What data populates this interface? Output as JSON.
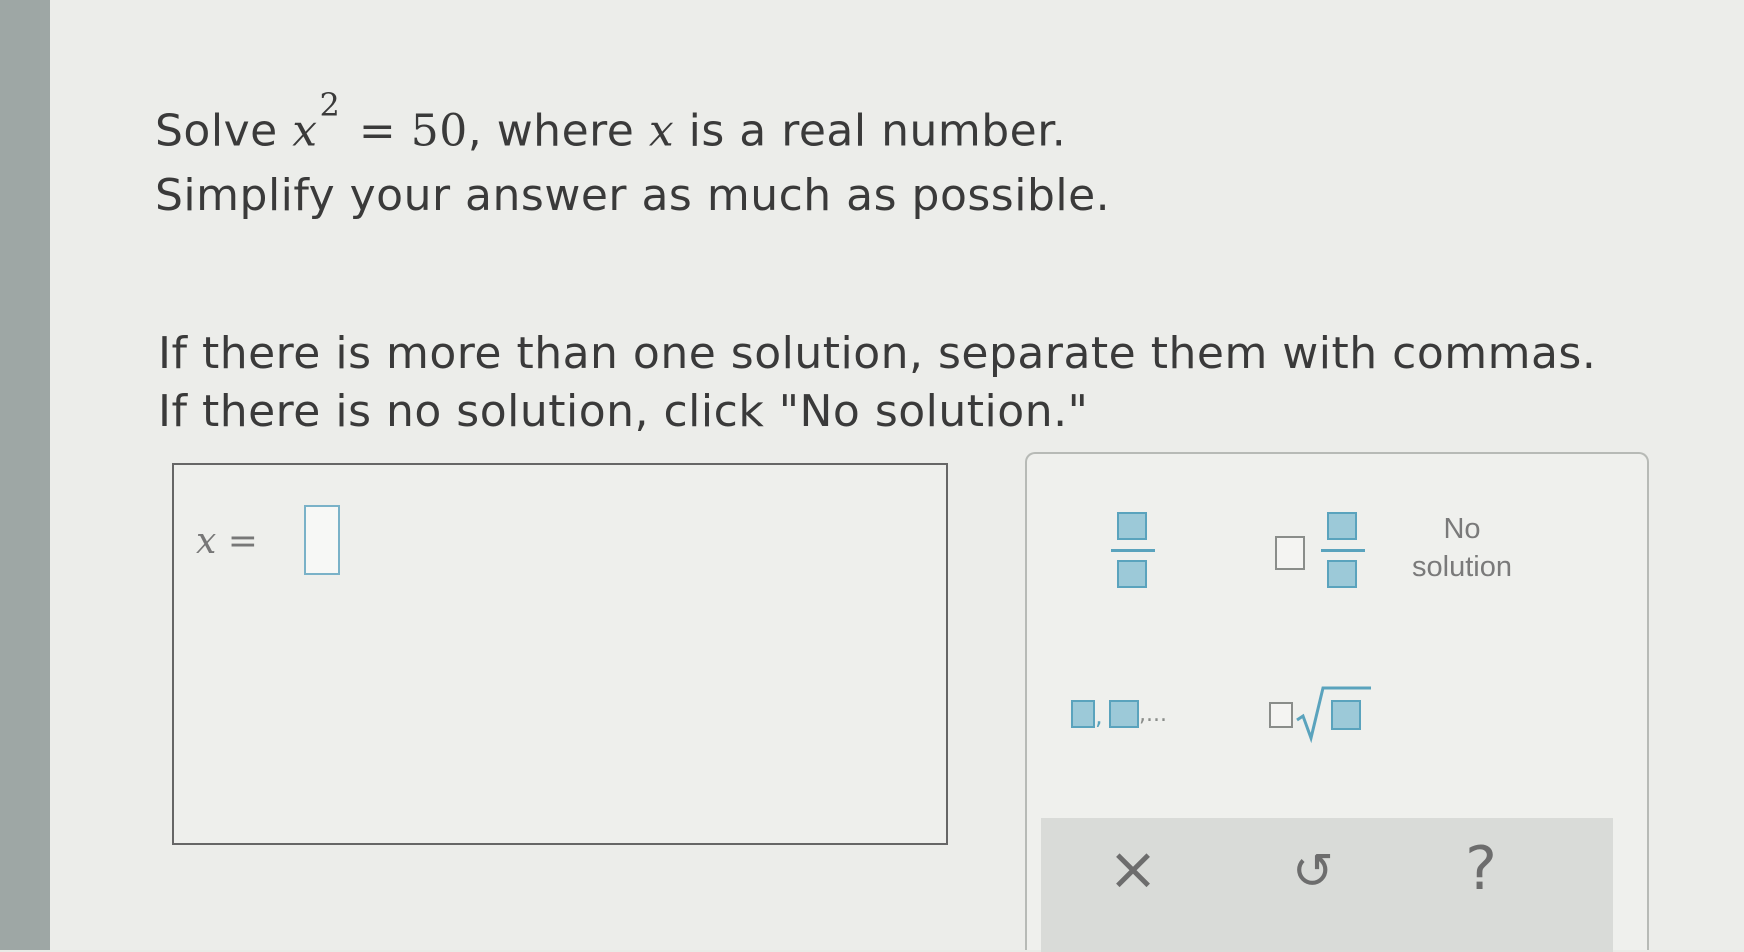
{
  "problem": {
    "solve_word": "Solve",
    "variable": "x",
    "exponent": "2",
    "equals_rhs": "= 50",
    "rest": ", where",
    "variable2": "x",
    "rest2": "is a real number.",
    "line2": "Simplify your answer as much as possible."
  },
  "instructions": {
    "line1": "If there is more than one solution, separate them with commas.",
    "line2": "If there is no solution, click \"No solution.\""
  },
  "answer": {
    "label_var": "x",
    "label_eq": "=",
    "value": ""
  },
  "keypad": {
    "no_solution_line1": "No",
    "no_solution_line2": "solution",
    "list_ellipsis": ",...",
    "list_comma": ",",
    "actions": {
      "clear": "×",
      "undo": "↺",
      "help": "?"
    }
  },
  "colors": {
    "accent": "#5aa3bd",
    "accent_fill": "#9cc9d8"
  }
}
